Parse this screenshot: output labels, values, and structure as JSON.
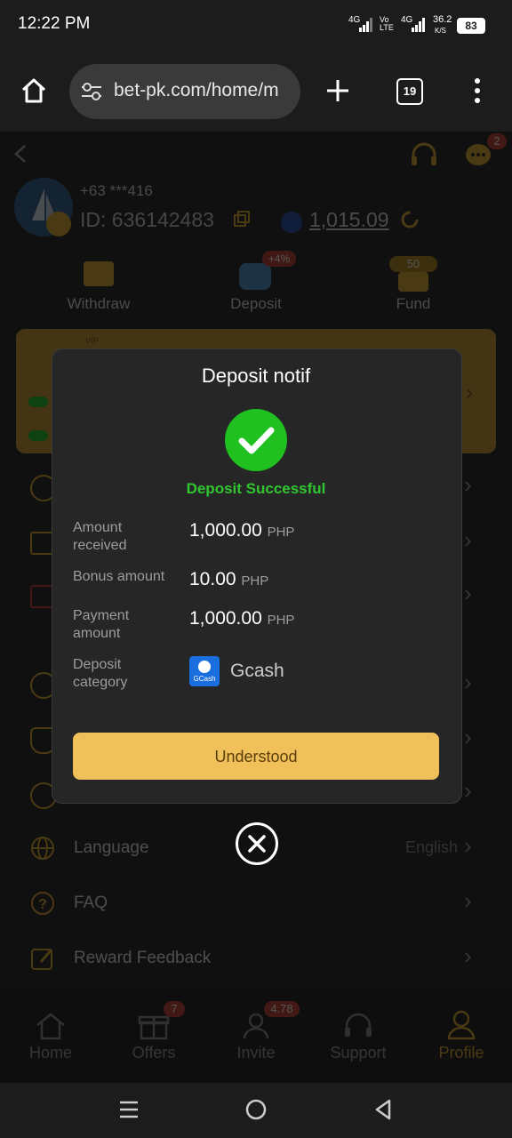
{
  "status_bar": {
    "time": "12:22 PM",
    "net1": "4G",
    "volte": "Vo LTE",
    "net2": "4G",
    "speed": "36.2",
    "speed_unit": "K/S",
    "battery": "83"
  },
  "browser": {
    "url": "bet-pk.com/home/m",
    "tab_count": "19"
  },
  "header": {
    "support_badge": "2"
  },
  "profile": {
    "phone": "+63 ***416",
    "id_label": "ID: 636142483",
    "balance": "1,015.09"
  },
  "actions": {
    "withdraw": "Withdraw",
    "deposit": "Deposit",
    "deposit_badge": "+4%",
    "fund": "Fund",
    "fund_badge": "50"
  },
  "vip": {
    "label": "VIP"
  },
  "menu": {
    "language": "Language",
    "language_value": "English",
    "faq": "FAQ",
    "reward_feedback": "Reward Feedback"
  },
  "bottom_nav": {
    "home": "Home",
    "offers": "Offers",
    "offers_badge": "7",
    "invite": "Invite",
    "invite_badge": "4.78",
    "support": "Support",
    "profile": "Profile"
  },
  "modal": {
    "title": "Deposit notif",
    "status": "Deposit Successful",
    "rows": [
      {
        "label": "Amount received",
        "value": "1,000.00",
        "unit": "PHP"
      },
      {
        "label": "Bonus amount",
        "value": "10.00",
        "unit": "PHP"
      },
      {
        "label": "Payment amount",
        "value": "1,000.00",
        "unit": "PHP"
      },
      {
        "label": "Deposit category",
        "value": "Gcash",
        "icon_text": "GCash"
      }
    ],
    "button": "Understood"
  },
  "colors": {
    "accent": "#f0c05a",
    "success": "#1fc01f",
    "background": "#161616",
    "gold": "#e0a92a"
  }
}
